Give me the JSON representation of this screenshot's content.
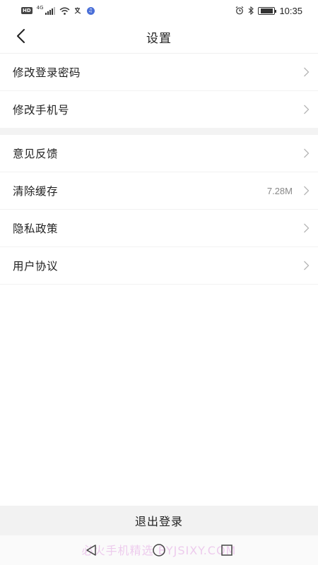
{
  "status_bar": {
    "hd": "HD",
    "network": "4G",
    "time": "10:35",
    "icons": [
      "hd-icon",
      "signal-icon",
      "wifi-icon",
      "translate-icon",
      "assistant-icon",
      "alarm-icon",
      "bluetooth-icon",
      "battery-icon"
    ]
  },
  "header": {
    "title": "设置",
    "back_icon": "chevron-left-icon"
  },
  "settings": {
    "group1": [
      {
        "label": "修改登录密码",
        "value": ""
      },
      {
        "label": "修改手机号",
        "value": ""
      }
    ],
    "group2": [
      {
        "label": "意见反馈",
        "value": ""
      },
      {
        "label": "清除缓存",
        "value": "7.28M"
      },
      {
        "label": "隐私政策",
        "value": ""
      },
      {
        "label": "用户协议",
        "value": ""
      }
    ]
  },
  "logout": {
    "label": "退出登录"
  },
  "watermark": "必火手机精选 BYJSIXY.COM",
  "system_nav": [
    "back-triangle-icon",
    "home-circle-icon",
    "recent-square-icon"
  ]
}
